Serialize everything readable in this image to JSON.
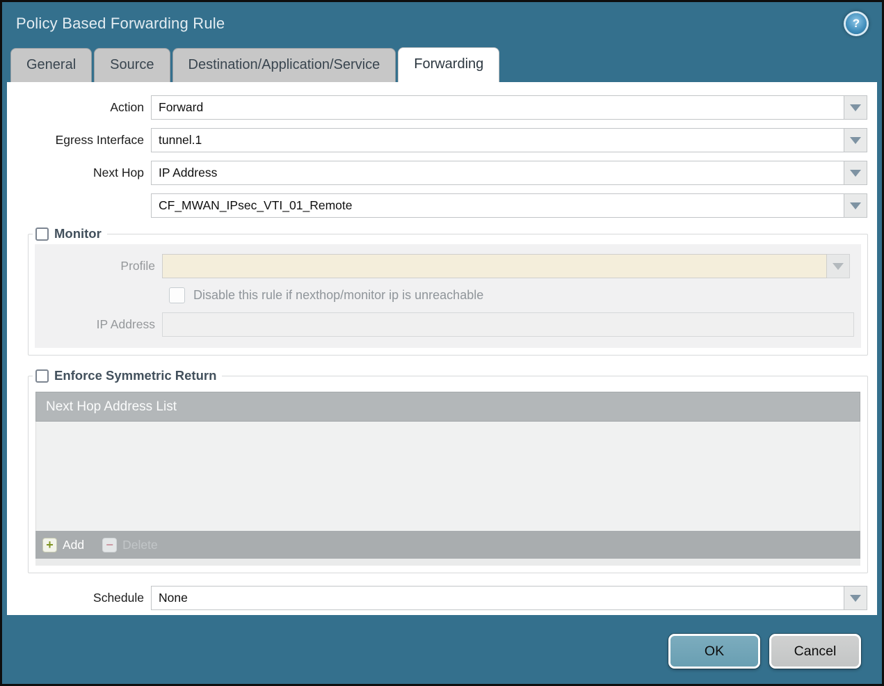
{
  "window": {
    "title": "Policy Based Forwarding Rule"
  },
  "icons": {
    "help_glyph": "?",
    "add_glyph": "+",
    "delete_glyph": "−"
  },
  "tabs": {
    "general": "General",
    "source": "Source",
    "destination": "Destination/Application/Service",
    "forwarding": "Forwarding"
  },
  "form": {
    "action_label": "Action",
    "action_value": "Forward",
    "egress_label": "Egress Interface",
    "egress_value": "tunnel.1",
    "next_hop_label": "Next Hop",
    "next_hop_value": "IP Address",
    "next_hop_address_value": "CF_MWAN_IPsec_VTI_01_Remote",
    "schedule_label": "Schedule",
    "schedule_value": "None"
  },
  "monitor": {
    "title": "Monitor",
    "profile_label": "Profile",
    "profile_value": "",
    "disable_checkbox_label": "Disable this rule if nexthop/monitor ip is unreachable",
    "ip_address_label": "IP Address",
    "ip_address_value": ""
  },
  "symmetric_return": {
    "title": "Enforce Symmetric Return",
    "list_header": "Next Hop Address List",
    "add_label": "Add",
    "delete_label": "Delete"
  },
  "footer": {
    "ok": "OK",
    "cancel": "Cancel"
  },
  "colors": {
    "titlebar_bg": "#34708d",
    "ok_button_bg": "#6fa5b9",
    "table_header_bg": "#b3b7b9",
    "disabled_field_bg": "#f4eedb"
  }
}
